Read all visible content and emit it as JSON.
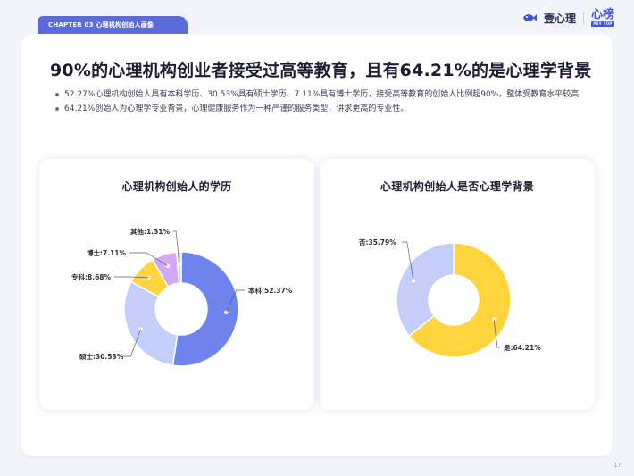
{
  "tab_label": "CHAPTER 03  心理机构创始人画像",
  "brand": {
    "name": "壹心理",
    "logo2_main": "心榜",
    "logo2_sub": "PSY TOP"
  },
  "headline": "90%的心理机构创业者接受过高等教育，且有64.21%的是心理学背景",
  "bullets": [
    "52.27%心理机构创始人具有本科学历、30.53%具有硕士学历、7.11%具有博士学历，接受高等教育的创始人比例超90%，整体受教育水平较高",
    "64.21%创始人为心理学专业背景，心理健康服务作为一种严谨的服务类型，讲求更高的专业性。"
  ],
  "page_number": "17",
  "chart_data": [
    {
      "type": "pie",
      "title": "心理机构创始人的学历",
      "slices": [
        {
          "label": "本科",
          "value": 52.37,
          "display": "本科:52.37%",
          "color": "#6f83ef"
        },
        {
          "label": "硕士",
          "value": 30.53,
          "display": "硕士:30.53%",
          "color": "#c4cef9"
        },
        {
          "label": "专科",
          "value": 8.68,
          "display": "专科:8.68%",
          "color": "#ffd43c"
        },
        {
          "label": "博士",
          "value": 7.11,
          "display": "博士:7.11%",
          "color": "#d3a9f6"
        },
        {
          "label": "其他",
          "value": 1.31,
          "display": "其他:1.31%",
          "color": "#b3dbe6"
        }
      ]
    },
    {
      "type": "pie",
      "title": "心理机构创始人是否心理学背景",
      "slices": [
        {
          "label": "是",
          "value": 64.21,
          "display": "是:64.21%",
          "color": "#ffd43c"
        },
        {
          "label": "否",
          "value": 35.79,
          "display": "否:35.79%",
          "color": "#c4cef9"
        }
      ]
    }
  ]
}
